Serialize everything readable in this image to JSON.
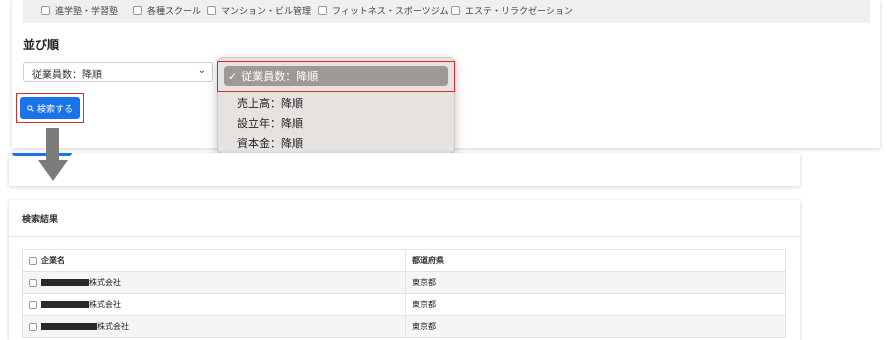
{
  "categories": [
    "進学塾・学習塾",
    "各種スクール",
    "マンション・ビル管理",
    "フィットネス・スポーツジム",
    "エステ・リラクゼーション"
  ],
  "sort": {
    "heading": "並び順",
    "current_value": "従業員数：降順",
    "options": [
      {
        "label": "従業員数：降順",
        "selected": true
      },
      {
        "label": "売上高：降順",
        "selected": false
      },
      {
        "label": "設立年：降順",
        "selected": false
      },
      {
        "label": "資本金：降順",
        "selected": false
      }
    ]
  },
  "search_button": {
    "label": "検索する"
  },
  "results": {
    "title": "検索結果",
    "columns": [
      "企業名",
      "都道府県"
    ],
    "rows": [
      {
        "company_suffix": "株式会社",
        "prefecture": "東京都"
      },
      {
        "company_suffix": "株式会社",
        "prefecture": "東京都"
      },
      {
        "company_suffix": "株式会社",
        "prefecture": "東京都"
      }
    ]
  },
  "colors": {
    "primary": "#1a73e8",
    "highlight": "#d62b2b",
    "arrow": "#7c7c7c"
  },
  "icons": {
    "search": "search-icon",
    "dropdown": "chevron-down-icon",
    "checkmark": "check-icon",
    "arrow": "down-arrow-icon"
  }
}
